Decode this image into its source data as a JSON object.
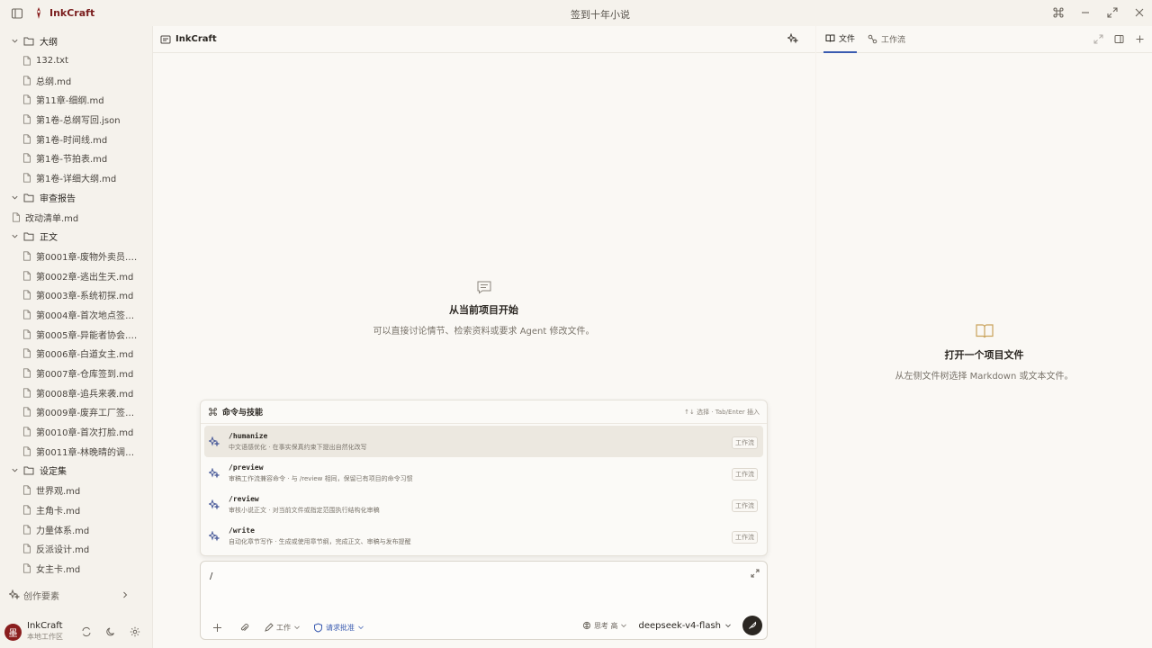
{
  "titlebar": {
    "app_name": "InkCraft",
    "window_title": "签到十年小说"
  },
  "tree": [
    {
      "type": "folder",
      "label": "大纲",
      "level": 0
    },
    {
      "type": "file",
      "label": "132.txt",
      "level": 1
    },
    {
      "type": "file",
      "label": "总纲.md",
      "level": 1
    },
    {
      "type": "file",
      "label": "第11章-细纲.md",
      "level": 1
    },
    {
      "type": "file",
      "label": "第1卷-总纲写回.json",
      "level": 1
    },
    {
      "type": "file",
      "label": "第1卷-时间线.md",
      "level": 1
    },
    {
      "type": "file",
      "label": "第1卷-节拍表.md",
      "level": 1
    },
    {
      "type": "file",
      "label": "第1卷-详细大纲.md",
      "level": 1
    },
    {
      "type": "folder",
      "label": "审查报告",
      "level": 0
    },
    {
      "type": "file",
      "label": "改动清单.md",
      "level": 0
    },
    {
      "type": "folder",
      "label": "正文",
      "level": 0
    },
    {
      "type": "file",
      "label": "第0001章-废物外卖员.md",
      "level": 1
    },
    {
      "type": "file",
      "label": "第0002章-逃出生天.md",
      "level": 1
    },
    {
      "type": "file",
      "label": "第0003章-系统初探.md",
      "level": 1
    },
    {
      "type": "file",
      "label": "第0004章-首次地点签到...",
      "level": 1
    },
    {
      "type": "file",
      "label": "第0005章-异能者协会.md",
      "level": 1
    },
    {
      "type": "file",
      "label": "第0006章-白道女主.md",
      "level": 1
    },
    {
      "type": "file",
      "label": "第0007章-仓库签到.md",
      "level": 1
    },
    {
      "type": "file",
      "label": "第0008章-追兵来袭.md",
      "level": 1
    },
    {
      "type": "file",
      "label": "第0009章-废弃工厂签到...",
      "level": 1
    },
    {
      "type": "file",
      "label": "第0010章-首次打脸.md",
      "level": 1
    },
    {
      "type": "file",
      "label": "第0011章-林晚晴的调查...",
      "level": 1
    },
    {
      "type": "folder",
      "label": "设定集",
      "level": 0
    },
    {
      "type": "file",
      "label": "世界观.md",
      "level": 1
    },
    {
      "type": "file",
      "label": "主角卡.md",
      "level": 1
    },
    {
      "type": "file",
      "label": "力量体系.md",
      "level": 1
    },
    {
      "type": "file",
      "label": "反派设计.md",
      "level": 1
    },
    {
      "type": "file",
      "label": "女主卡.md",
      "level": 1
    }
  ],
  "sidebar_bottom": {
    "elements_label": "创作要素",
    "user_name": "InkCraft",
    "user_sub": "本地工作区",
    "avatar_char": "墨"
  },
  "main": {
    "header_title": "InkCraft",
    "empty_title": "从当前项目开始",
    "empty_desc": "可以直接讨论情节、检索资料或要求 Agent 修改文件。"
  },
  "command_palette": {
    "title": "命令与技能",
    "hint": "↑↓ 选择 · Tab/Enter 插入",
    "items": [
      {
        "name": "/humanize",
        "desc": "中文语感优化 · 在事实保真约束下提出自然化改写",
        "tag": "工作流"
      },
      {
        "name": "/preview",
        "desc": "审稿工作流兼容命令 · 与 /review 相同，保留已有项目的命令习惯",
        "tag": "工作流"
      },
      {
        "name": "/review",
        "desc": "审核小说正文 · 对当前文件或指定范围执行结构化审稿",
        "tag": "工作流"
      },
      {
        "name": "/write",
        "desc": "自动化章节写作 · 生成或使用章节纲，完成正文、审稿与发布提醒",
        "tag": "工作流"
      }
    ]
  },
  "composer": {
    "value": "/",
    "mode_label": "工作",
    "approval_label": "请求批准",
    "think_label": "思考 高",
    "model_label": "deepseek-v4-flash"
  },
  "right_panel": {
    "tab_files": "文件",
    "tab_workflow": "工作流",
    "empty_title": "打开一个项目文件",
    "empty_desc": "从左侧文件树选择 Markdown 或文本文件。"
  },
  "colors": {
    "accent": "#3a5bb0",
    "brand": "#8a1e1e",
    "background": "#f5f2ec"
  }
}
